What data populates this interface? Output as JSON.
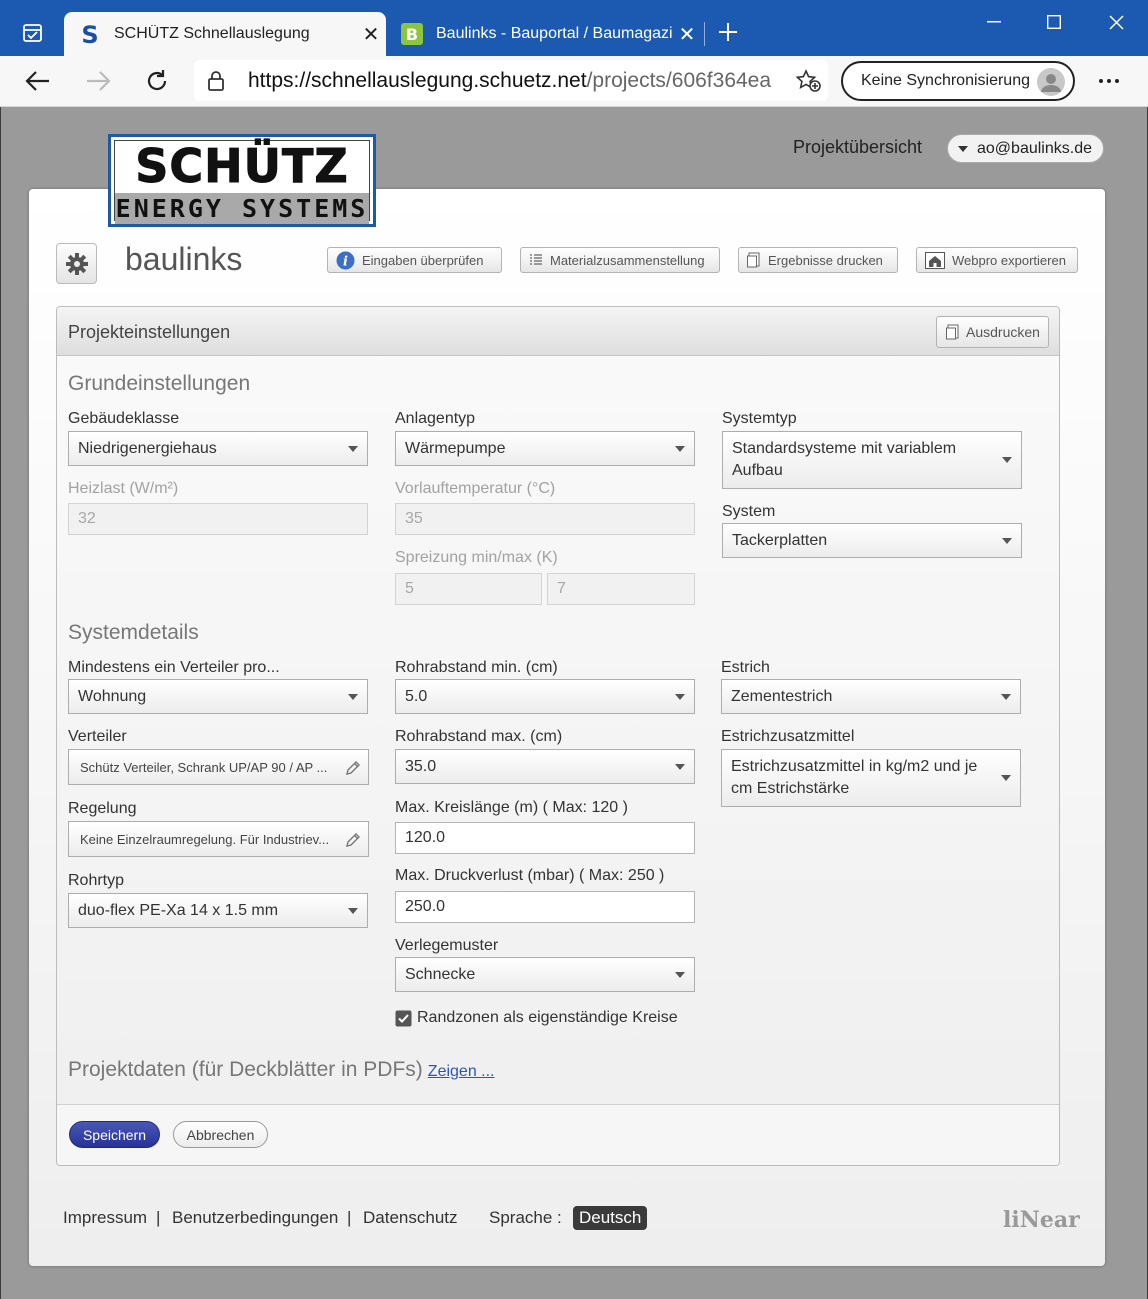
{
  "browser": {
    "tabs": [
      {
        "title": "SCHÜTZ Schnellauslegung",
        "favicon": "S",
        "active": true
      },
      {
        "title": "Baulinks - Bauportal / Baumagazin",
        "favicon": "B",
        "active": false
      }
    ],
    "url_main": "https://schnellauslegung.schuetz.net",
    "url_path": "/projects/606f364ea",
    "sync_label": "Keine Synchronisierung",
    "colors": {
      "titlebar": "#1c59b0"
    }
  },
  "header": {
    "logo_line1": "SCHÜTZ",
    "logo_line2": "ENERGY SYSTEMS",
    "project_overview": "Projektübersicht",
    "user": "ao@baulinks.de"
  },
  "project": {
    "name": "baulinks",
    "toolbar": {
      "check": "Eingaben überprüfen",
      "materials": "Materialzusammenstellung",
      "print_results": "Ergebnisse drucken",
      "export": "Webpro exportieren"
    }
  },
  "panel": {
    "title": "Projekteinstellungen",
    "print": "Ausdrucken",
    "basic": {
      "heading": "Grundeinstellungen",
      "building_class_label": "Gebäudeklasse",
      "building_class": "Niedrigenergiehaus",
      "plant_type_label": "Anlagentyp",
      "plant_type": "Wärmepumpe",
      "system_type_label": "Systemtyp",
      "system_type": "Standardsysteme mit variablem Aufbau",
      "heat_load_label": "Heizlast (W/m²)",
      "heat_load": "32",
      "flow_temp_label": "Vorlauftemperatur (°C)",
      "flow_temp": "35",
      "system_label": "System",
      "system": "Tackerplatten",
      "spread_label": "Spreizung min/max (K)",
      "spread_min": "5",
      "spread_max": "7"
    },
    "details": {
      "heading": "Systemdetails",
      "distributor_per_label": "Mindestens ein Verteiler pro...",
      "distributor_per": "Wohnung",
      "pipe_min_label": "Rohrabstand min. (cm)",
      "pipe_min": "5.0",
      "screed_label": "Estrich",
      "screed": "Zementestrich",
      "distributor_label": "Verteiler",
      "distributor": "Schütz Verteiler, Schrank UP/AP 90 / AP ...",
      "pipe_max_label": "Rohrabstand max. (cm)",
      "pipe_max": "35.0",
      "additive_label": "Estrichzusatzmittel",
      "additive": "Estrichzusatzmittel in kg/m2 und je cm Estrichstärke",
      "control_label": "Regelung",
      "control": "Keine Einzelraumregelung. Für Industriev...",
      "circuit_len_label": "Max. Kreislänge (m) ( Max: 120 )",
      "circuit_len": "120.0",
      "pipe_type_label": "Rohrtyp",
      "pipe_type": "duo-flex PE-Xa 14 x 1.5 mm",
      "pressure_label": "Max. Druckverlust (mbar) ( Max: 250 )",
      "pressure": "250.0",
      "pattern_label": "Verlegemuster",
      "pattern": "Schnecke",
      "edge_zones_label": "Randzonen als eigenständige Kreise",
      "edge_zones_checked": true
    },
    "project_data": {
      "heading": "Projektdaten (für Deckblätter in PDFs)",
      "show_link": "Zeigen ..."
    },
    "save": "Speichern",
    "cancel": "Abbrechen"
  },
  "footer": {
    "imprint": "Impressum",
    "sep1": "|",
    "terms": "Benutzerbedingungen",
    "sep2": "|",
    "privacy": "Datenschutz",
    "language_label": "Sprache :",
    "language": "Deutsch",
    "brand": "liNear"
  }
}
